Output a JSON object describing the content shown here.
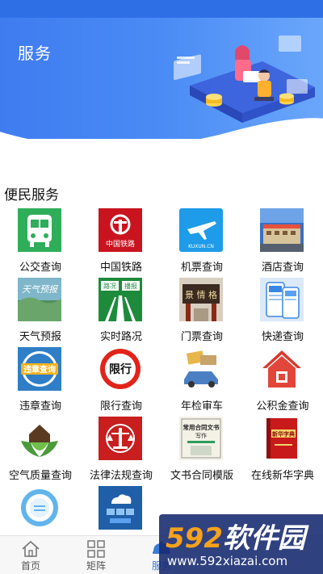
{
  "header": {
    "title": "服务"
  },
  "section": {
    "title": "便民服务"
  },
  "services": [
    {
      "label": "公交查询",
      "icon": "bus-icon"
    },
    {
      "label": "中国铁路",
      "icon": "china-railway-icon",
      "icon_text": "中国铁路"
    },
    {
      "label": "机票查询",
      "icon": "airplane-icon",
      "icon_text": "KUXUN.CN"
    },
    {
      "label": "酒店查询",
      "icon": "hotel-building-icon"
    },
    {
      "label": "天气预报",
      "icon": "weather-photo-icon",
      "icon_text": "天气预报"
    },
    {
      "label": "实时路况",
      "icon": "road-sign-icon",
      "icon_text_left": "路况",
      "icon_text_right": "播报"
    },
    {
      "label": "门票查询",
      "icon": "ticket-gate-icon",
      "icon_text": "景 情 格"
    },
    {
      "label": "快递查询",
      "icon": "express-app-icon"
    },
    {
      "label": "违章查询",
      "icon": "violation-badge-icon",
      "icon_text": "违章查询"
    },
    {
      "label": "限行查询",
      "icon": "restriction-sign-icon",
      "icon_text": "限行"
    },
    {
      "label": "年检审车",
      "icon": "car-inspection-icon"
    },
    {
      "label": "公积金查询",
      "icon": "house-fund-icon"
    },
    {
      "label": "空气质量查询",
      "icon": "green-house-icon"
    },
    {
      "label": "法律法规查询",
      "icon": "law-emblem-icon"
    },
    {
      "label": "文书合同模版",
      "icon": "contract-book-icon",
      "icon_text": "常用合同文书",
      "icon_subtext": "写作"
    },
    {
      "label": "在线新华字典",
      "icon": "dictionary-icon",
      "icon_text": "新华字典"
    },
    {
      "label": "",
      "icon": "cycle-diagram-icon"
    },
    {
      "label": "",
      "icon": "cloud-flow-icon"
    }
  ],
  "tabs": [
    {
      "label": "首页",
      "icon": "home-icon"
    },
    {
      "label": "矩阵",
      "icon": "grid-icon"
    },
    {
      "label": "服务",
      "icon": "service-icon",
      "active": true
    }
  ],
  "watermark": {
    "num": "592",
    "brand": "软件园",
    "url": "www.592xiazai.com"
  },
  "colors": {
    "header": "#3f7cf0",
    "accent": "#3a7bd5",
    "watermark_bg": "#14286e",
    "watermark_num": "#f7a21b"
  }
}
